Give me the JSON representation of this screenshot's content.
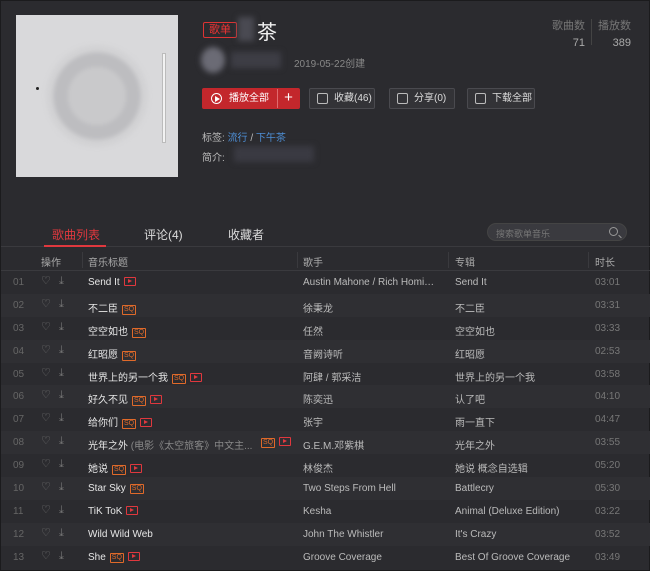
{
  "header": {
    "badge": "歌单",
    "title": "茶",
    "created": "2019-05-22创建",
    "stats": {
      "songs_label": "歌曲数",
      "songs_value": "71",
      "plays_label": "播放数",
      "plays_value": "389"
    },
    "buttons": {
      "play_all": "播放全部",
      "add": "+",
      "collect": "收藏(46)",
      "share": "分享(0)",
      "download_all": "下载全部"
    },
    "tags_label": "标签:",
    "tags": [
      "流行",
      "下午茶"
    ],
    "tags_sep": "/",
    "intro_label": "简介:"
  },
  "tabs": {
    "songs": "歌曲列表",
    "comments": "评论(4)",
    "collectors": "收藏者"
  },
  "search": {
    "placeholder": "搜索歌单音乐"
  },
  "table": {
    "headers": {
      "ops": "操作",
      "title": "音乐标题",
      "artist": "歌手",
      "album": "专辑",
      "duration": "时长"
    },
    "rows": [
      {
        "idx": "01",
        "title": "Send It",
        "sub": "",
        "sq": false,
        "mv": true,
        "artist": "Austin Mahone / Rich Homie ...",
        "album": "Send It",
        "time": "03:01"
      },
      {
        "idx": "02",
        "title": "不二臣",
        "sub": "",
        "sq": true,
        "mv": false,
        "artist": "徐秉龙",
        "album": "不二臣",
        "time": "03:31"
      },
      {
        "idx": "03",
        "title": "空空如也",
        "sub": "",
        "sq": true,
        "mv": false,
        "artist": "任然",
        "album": "空空如也",
        "time": "03:33"
      },
      {
        "idx": "04",
        "title": "红昭愿",
        "sub": "",
        "sq": true,
        "mv": false,
        "artist": "音阙诗听",
        "album": "红昭愿",
        "time": "02:53"
      },
      {
        "idx": "05",
        "title": "世界上的另一个我",
        "sub": "",
        "sq": true,
        "mv": true,
        "artist": "阿肆 / 郭采洁",
        "album": "世界上的另一个我",
        "time": "03:58"
      },
      {
        "idx": "06",
        "title": "好久不见",
        "sub": "",
        "sq": true,
        "mv": true,
        "artist": "陈奕迅",
        "album": "认了吧",
        "time": "04:10"
      },
      {
        "idx": "07",
        "title": "给你们",
        "sub": "",
        "sq": true,
        "mv": true,
        "artist": "张宇",
        "album": "雨一直下",
        "time": "04:47"
      },
      {
        "idx": "08",
        "title": "光年之外",
        "sub": "(电影《太空旅客》中文主...",
        "sq": true,
        "mv": true,
        "artist": "G.E.M.邓紫棋",
        "album": "光年之外",
        "time": "03:55"
      },
      {
        "idx": "09",
        "title": "她说",
        "sub": "",
        "sq": true,
        "mv": true,
        "artist": "林俊杰",
        "album": "她说 概念自选辑",
        "time": "05:20"
      },
      {
        "idx": "10",
        "title": "Star Sky",
        "sub": "",
        "sq": true,
        "mv": false,
        "artist": "Two Steps From Hell",
        "album": "Battlecry",
        "time": "05:30"
      },
      {
        "idx": "11",
        "title": "TiK ToK",
        "sub": "",
        "sq": false,
        "mv": true,
        "artist": "Kesha",
        "album": "Animal (Deluxe Edition)",
        "time": "03:22"
      },
      {
        "idx": "12",
        "title": "Wild Wild Web",
        "sub": "",
        "sq": false,
        "mv": false,
        "artist": "John The Whistler",
        "album": "It's Crazy",
        "time": "03:52"
      },
      {
        "idx": "13",
        "title": "She",
        "sub": "",
        "sq": true,
        "mv": true,
        "artist": "Groove Coverage",
        "album": "Best Of Groove Coverage",
        "time": "03:49"
      }
    ]
  },
  "colors": {
    "accent": "#e0383e",
    "link": "#4e8fd6",
    "background": "#2b2b2f"
  }
}
